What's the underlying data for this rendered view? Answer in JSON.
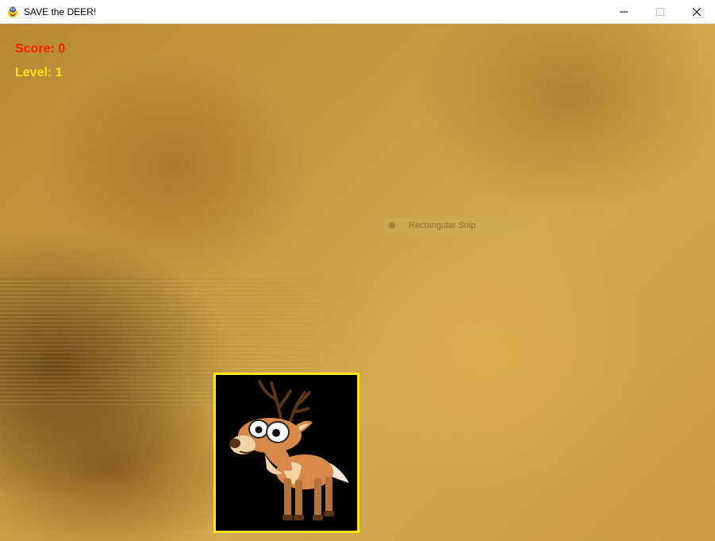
{
  "window": {
    "title": "SAVE the DEER!",
    "icon": "pygame-snake-icon",
    "controls": [
      "minimize-icon",
      "maximize-icon",
      "close-icon"
    ]
  },
  "hud": {
    "score_text": "Score: 0",
    "level_text": "Level: 1",
    "score_color": "#ff1a00",
    "level_color": "#ffe21a"
  },
  "overlay": {
    "snip_label": "Rectangular Snip"
  },
  "player": {
    "sprite": "deer-icon",
    "frame_color": "#ffe600"
  }
}
